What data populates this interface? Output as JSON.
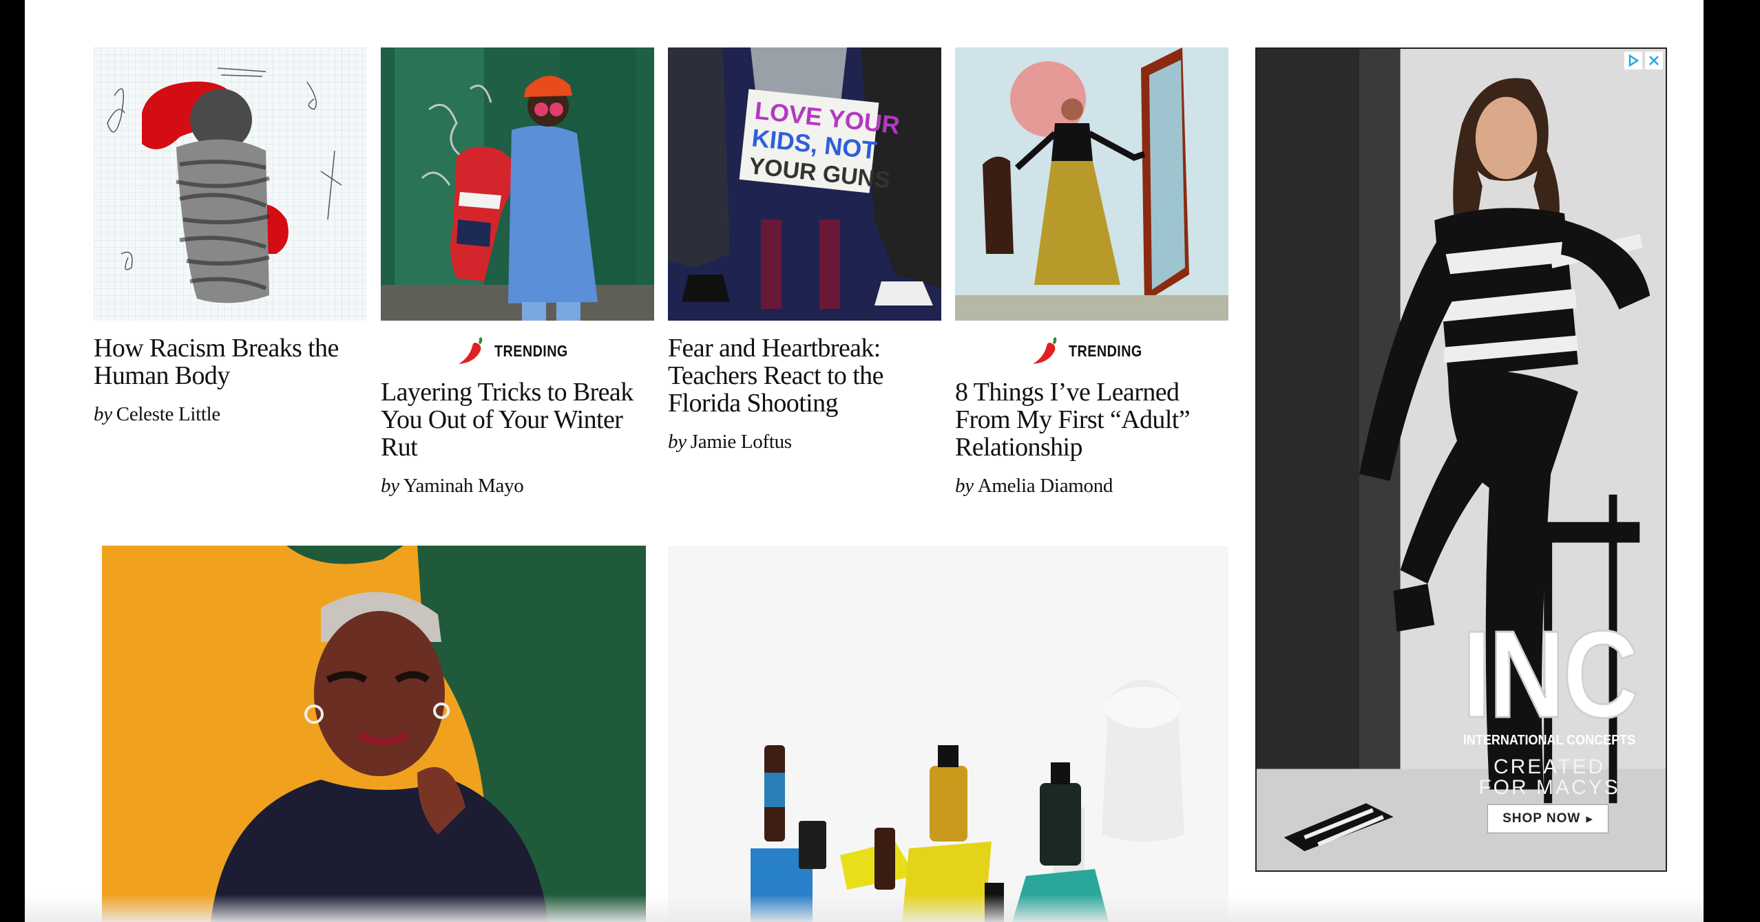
{
  "trending_label": "TRENDING",
  "by_word": "by",
  "articles": [
    {
      "title": "How Racism Breaks the Human Body",
      "author": "Celeste Little",
      "trending": false
    },
    {
      "title": "Layering Tricks to Break You Out of Your Winter Rut",
      "author": "Yaminah Mayo",
      "trending": true
    },
    {
      "title": "Fear and Heartbreak: Teachers React to the Florida Shooting",
      "author": "Jamie Loftus",
      "trending": false
    },
    {
      "title": "8 Things I’ve Learned From My First “Adult” Relationship",
      "author": "Amelia Diamond",
      "trending": true
    }
  ],
  "protest_sign": {
    "line1": "LOVE YOUR",
    "line2": "KIDS, NOT",
    "line3": "YOUR GUNS"
  },
  "ad": {
    "brand": "INC",
    "subbrand": "INTERNATIONAL CONCEPTS",
    "tagline_1": "CREATED",
    "tagline_2": "FOR MACYS",
    "cta": "SHOP NOW",
    "cta_arrow": "▸"
  },
  "colors": {
    "accent_red": "#d01b1b",
    "chili_red": "#e02020",
    "chili_green": "#2f8a2f"
  }
}
